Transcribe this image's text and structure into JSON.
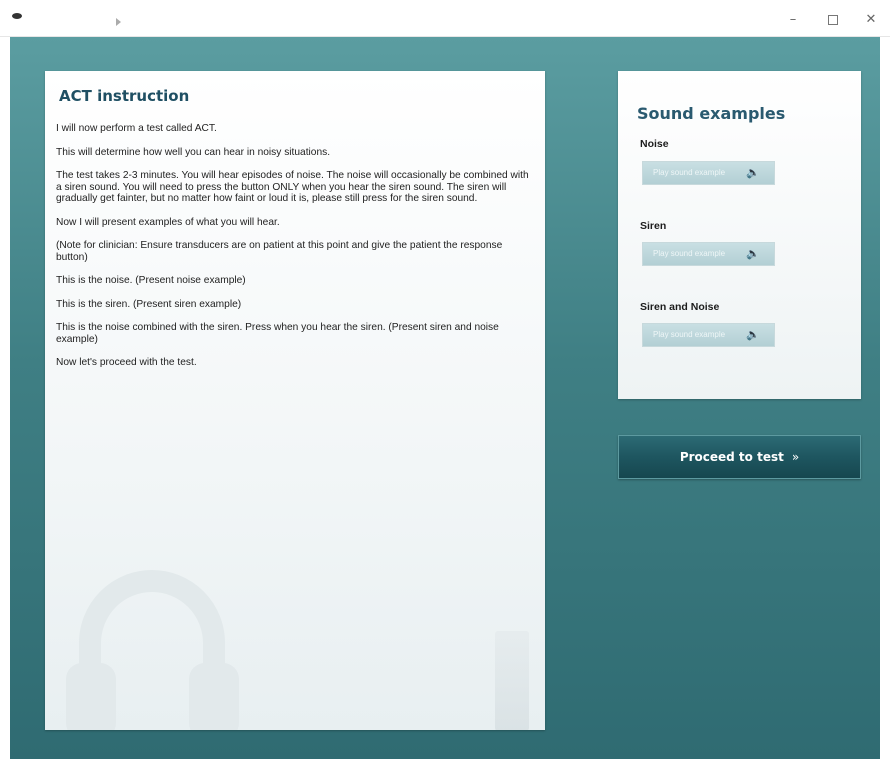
{
  "window": {
    "controls": {
      "minimize": "–",
      "maximize": "",
      "close": "✕"
    }
  },
  "instruction": {
    "title": "ACT instruction",
    "paragraphs": [
      "I will now perform a test called ACT.",
      "This will determine how well you can hear in noisy situations.",
      "The test takes 2-3 minutes. You will hear episodes of noise. The noise will occasionally be combined with a siren sound. You will need to press the button ONLY when you hear the siren sound. The siren will gradually get fainter, but no matter how faint or loud it is, please still press for the siren sound.",
      "Now I will present examples of what you will hear.",
      "(Note for clinician: Ensure transducers are on patient at this point and give the patient the response button)",
      "This is the noise. (Present noise example)",
      "This is the siren. (Present siren example)",
      "This is the noise combined with the siren. Press when you hear the siren. (Present siren and noise example)",
      "Now let's proceed with the test."
    ]
  },
  "sound_examples": {
    "title": "Sound examples",
    "items": [
      {
        "label": "Noise",
        "button_label": "Play sound example",
        "icon": "speaker-icon"
      },
      {
        "label": "Siren",
        "button_label": "Play sound example",
        "icon": "speaker-icon"
      },
      {
        "label": "Siren and Noise",
        "button_label": "Play sound example",
        "icon": "speaker-icon"
      }
    ]
  },
  "proceed": {
    "label": "Proceed to test",
    "chevron": "»"
  },
  "colors": {
    "accent": "#1f4f63",
    "background_top": "#5b9da1",
    "background_bottom": "#2f6b72",
    "proceed_button": "#1e5660"
  }
}
